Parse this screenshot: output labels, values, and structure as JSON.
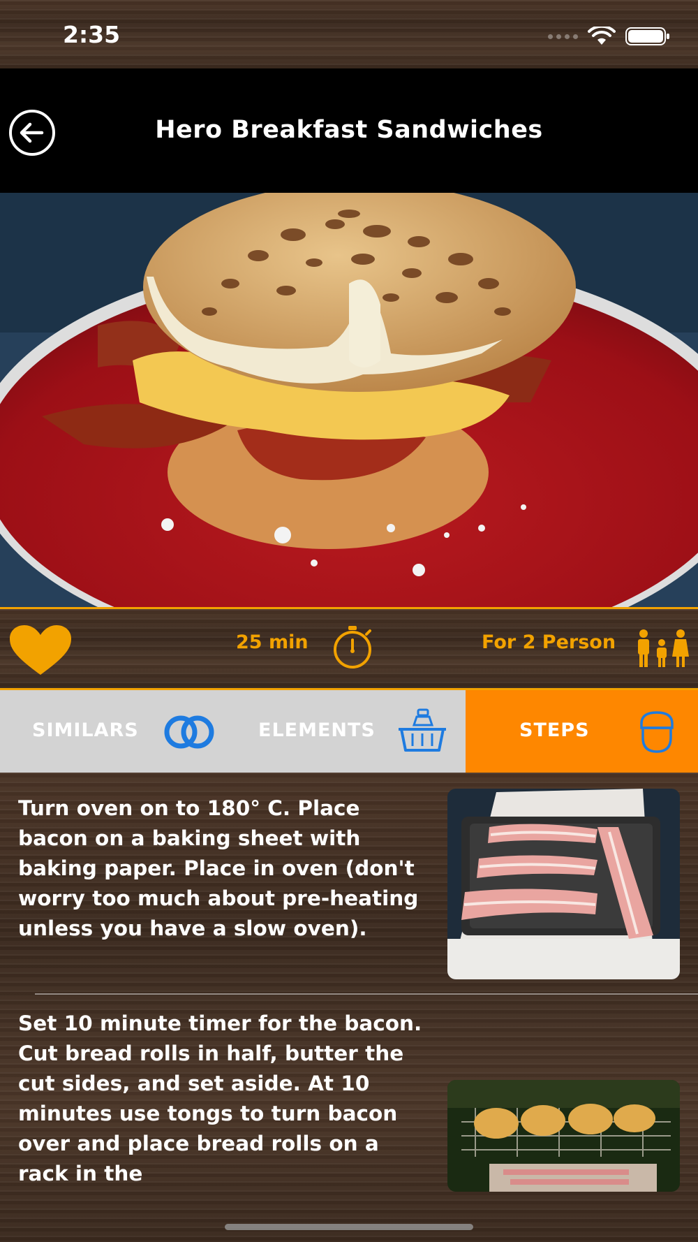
{
  "status_bar": {
    "time": "2:35"
  },
  "nav": {
    "title": "Hero Breakfast Sandwiches"
  },
  "info": {
    "time_label": "25 min",
    "servings_label": "For 2 Person"
  },
  "tabs": [
    {
      "label": "SIMILARS",
      "icon": "linked-rings-icon",
      "active": false
    },
    {
      "label": "ELEMENTS",
      "icon": "grocery-basket-icon",
      "active": false
    },
    {
      "label": "STEPS",
      "icon": "chef-icon",
      "active": true
    }
  ],
  "steps": [
    {
      "text": "Turn oven on to 180° C. Place bacon on a baking sheet with baking paper. Place in oven (don't worry too much about pre-heating unless you have a slow oven)."
    },
    {
      "text": "Set 10 minute timer for the bacon. Cut bread rolls in half, butter the cut sides, and set aside. At 10 minutes use tongs to turn bacon over and place bread rolls on a rack in the"
    }
  ],
  "colors": {
    "accent": "#f2a200",
    "active_tab": "#fe8700",
    "tab_icon": "#1e7be0",
    "tab_bar": "#d3d3d3",
    "nav": "#000000"
  }
}
